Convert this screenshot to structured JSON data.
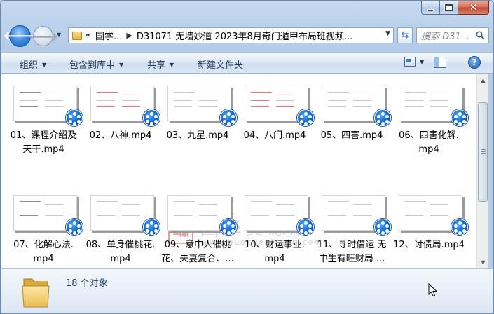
{
  "window": {
    "caption_buttons": [
      "minimize",
      "maximize",
      "close"
    ]
  },
  "nav": {
    "back_icon": "back-arrow-icon",
    "forward_icon": "forward-arrow-icon",
    "breadcrumb_prefix": "«",
    "breadcrumb": [
      "国学...",
      "D31071 无墙妙道 2023年8月奇门遁甲布局班视频..."
    ],
    "search_placeholder": "搜索 D31...",
    "refresh_icon": "refresh-icon"
  },
  "toolbar": {
    "organize": "组织",
    "include_in_library": "包含到库中",
    "share": "共享",
    "new_folder": "新建文件夹"
  },
  "files": [
    {
      "label": "01、课程介绍及天干.mp4",
      "lines": [
        "01、课程介绍及",
        "天干.mp4"
      ]
    },
    {
      "label": "02、八神.mp4",
      "lines": [
        "02、八神.mp4"
      ]
    },
    {
      "label": "03、九星.mp4",
      "lines": [
        "03、九星.mp4"
      ]
    },
    {
      "label": "04、八门.mp4",
      "lines": [
        "04、八门.mp4"
      ]
    },
    {
      "label": "05、四害.mp4",
      "lines": [
        "05、四害.mp4"
      ]
    },
    {
      "label": "06、四害化解.mp4",
      "lines": [
        "06、四害化解.",
        "mp4"
      ]
    },
    {
      "label": "07、化解心法.mp4",
      "lines": [
        "07、化解心法.",
        "mp4"
      ]
    },
    {
      "label": "08、单身催桃花.mp4",
      "lines": [
        "08、单身催桃花.",
        "mp4"
      ]
    },
    {
      "label": "09、意中人催桃花、夫妻复合、...",
      "lines": [
        "09、意中人催桃",
        "花、夫妻复合、..."
      ]
    },
    {
      "label": "10、财运事业.mp4",
      "lines": [
        "10、财运事业.",
        "mp4"
      ]
    },
    {
      "label": "11、寻时借运 无中生有旺财局 ...",
      "lines": [
        "11、寻时借运 无",
        "中生有旺财局 ..."
      ]
    },
    {
      "label": "12、讨债局.mp4",
      "lines": [
        "12、讨债局.mp4"
      ]
    }
  ],
  "watermark": {
    "seal": "臨",
    "title": "國學資源網",
    "url": "www.guoxueziyuan.com"
  },
  "details": {
    "item_count": "18 个对象"
  },
  "colors": {
    "accent": "#1e395b",
    "player": "#0c62c9"
  }
}
